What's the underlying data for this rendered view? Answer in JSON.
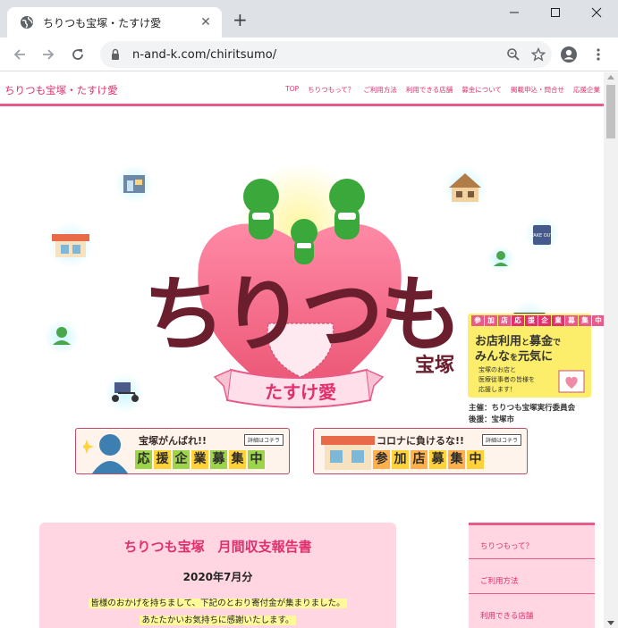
{
  "browser": {
    "tab_title": "ちりつも宝塚・たすけ愛",
    "new_tab": "+",
    "url": "n-and-k.com/chiritsumo/"
  },
  "site": {
    "title": "ちりつも宝塚・たすけ愛",
    "nav": [
      "TOP",
      "ちりつもって？",
      "ご利用方法",
      "利用できる店舗",
      "募金について",
      "掲載申込・問合せ",
      "応援企業"
    ]
  },
  "hero": {
    "logo_main": "ちりつも",
    "logo_sub": "宝塚",
    "logo_ribbon": "たすけ愛",
    "sponsor": {
      "tags": [
        "参",
        "加",
        "店",
        "応",
        "援",
        "企",
        "業",
        "募",
        "集",
        "中"
      ],
      "line1_pre": "お店利用",
      "line1_mid": "と",
      "line1_post": "募金",
      "line1_end": "で",
      "line2_pre": "みんな",
      "line2_mid": "を",
      "line2_post": "元気に",
      "sub1": "宝塚のお店と",
      "sub2": "医療従事者の皆様を",
      "sub3": "応援します！"
    },
    "organizer": "主催：ちりつも宝塚実行委員会",
    "supporter": "後援：宝塚市"
  },
  "banners": {
    "left": {
      "top": "宝塚がんばれ!!",
      "tag": "詳細はコチラ",
      "chars": [
        "応",
        "援",
        "企",
        "業",
        "募",
        "集",
        "中"
      ]
    },
    "right": {
      "top": "コロナに負けるな!!",
      "tag": "詳細はコチラ",
      "chars": [
        "参",
        "加",
        "店",
        "募",
        "集",
        "中"
      ]
    }
  },
  "report": {
    "title": "ちりつも宝塚　月間収支報告書",
    "date": "2020年7月分",
    "line1": "皆様のおかげを持ちまして、下記のとおり寄付金が集まりました。",
    "line2": "あたたかいお気持ちに感謝いたします。"
  },
  "sidebar": {
    "items": [
      "ちりつもって？",
      "ご利用方法",
      "利用できる店舗"
    ]
  },
  "icon_labels": {
    "take_out": "TAKE OUT"
  },
  "colors": {
    "brand_pink": "#e85a8a",
    "brand_text": "#e0306e",
    "logo_maroon": "#6b1e2e"
  }
}
